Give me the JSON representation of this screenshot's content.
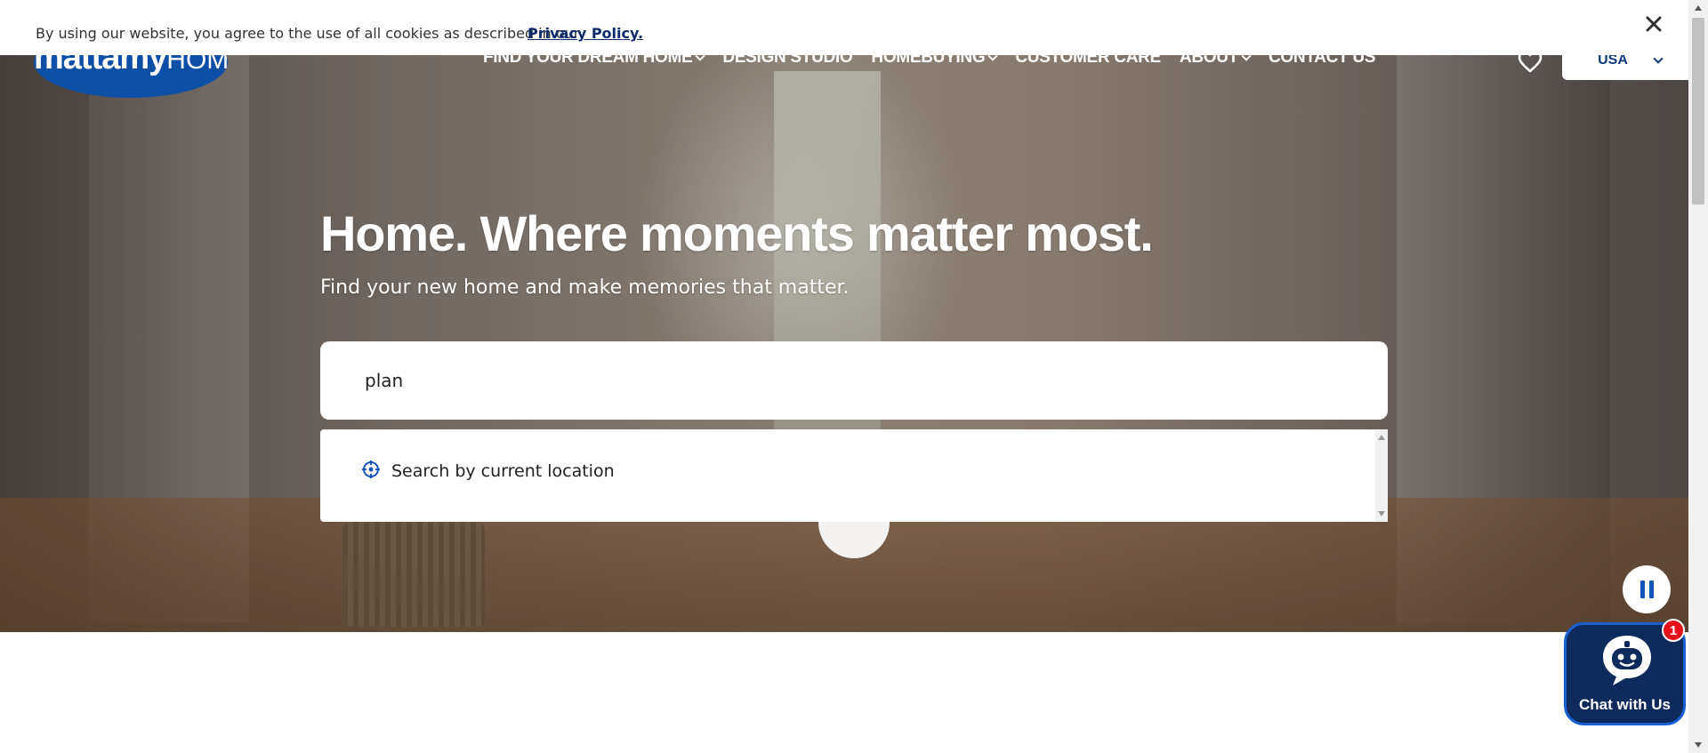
{
  "cookie_banner": {
    "text": "By using our website, you agree to the use of all cookies as described in our",
    "link_label": "Privacy Policy.",
    "close_icon": "close-icon"
  },
  "brand": {
    "logo_main": "mattamy",
    "logo_suffix": "HOMES",
    "color": "#0d4ea6"
  },
  "nav": {
    "items": [
      {
        "label": "FIND YOUR DREAM HOME",
        "has_dropdown": true
      },
      {
        "label": "DESIGN STUDIO",
        "has_dropdown": false
      },
      {
        "label": "HOMEBUYING",
        "has_dropdown": true
      },
      {
        "label": "CUSTOMER CARE",
        "has_dropdown": false
      },
      {
        "label": "ABOUT",
        "has_dropdown": true
      },
      {
        "label": "CONTACT US",
        "has_dropdown": false
      }
    ],
    "favorites_icon": "heart-icon",
    "country_selector": {
      "value": "USA"
    }
  },
  "hero": {
    "headline": "Home. Where moments matter most.",
    "subhead": "Find your new home and make memories that matter."
  },
  "search": {
    "value": "plan",
    "dropdown": {
      "items": [
        {
          "label": "Search by current location",
          "icon": "location-crosshair-icon"
        }
      ]
    }
  },
  "controls": {
    "pause_icon": "pause-icon"
  },
  "chat": {
    "label": "Chat with Us",
    "badge_count": "1",
    "icon": "chatbot-icon"
  },
  "colors": {
    "accent": "#1257b8",
    "navy": "#0d2a5c",
    "badge": "#e5121b"
  }
}
